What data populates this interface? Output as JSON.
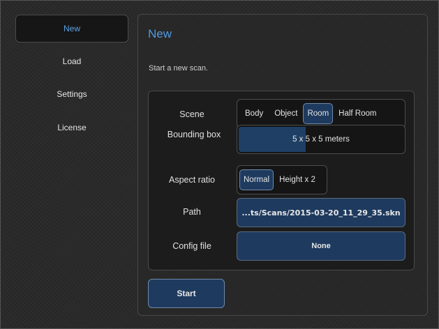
{
  "sidebar": {
    "items": [
      {
        "label": "New",
        "active": true
      },
      {
        "label": "Load",
        "active": false
      },
      {
        "label": "Settings",
        "active": false
      },
      {
        "label": "License",
        "active": false
      }
    ]
  },
  "panel": {
    "title": "New",
    "subtitle": "Start a new scan."
  },
  "form": {
    "scene": {
      "label": "Scene",
      "options": [
        "Body",
        "Object",
        "Room",
        "Half Room"
      ],
      "selected": "Room"
    },
    "bounding_box": {
      "label": "Bounding box",
      "value": "5 x 5 x 5 meters",
      "level_fraction": 0.41
    },
    "aspect_ratio": {
      "label": "Aspect ratio",
      "options": [
        "Normal",
        "Height x 2"
      ],
      "selected": "Normal"
    },
    "path": {
      "label": "Path",
      "value": "...ts/Scans/2015-03-20_11_29_35.skn"
    },
    "config_file": {
      "label": "Config file",
      "value": "None"
    }
  },
  "start_button": {
    "label": "Start"
  },
  "colors": {
    "accent": "#4f9ae0",
    "button_fill": "#1e3a5e",
    "background": "#2a2a2a"
  }
}
